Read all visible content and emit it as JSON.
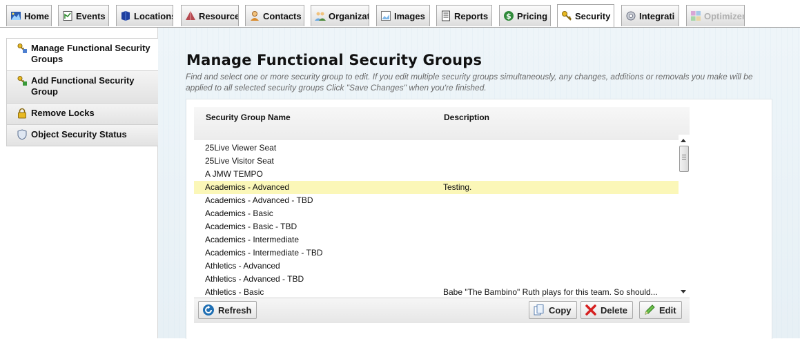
{
  "tabs": [
    {
      "label": "Home",
      "icon": "home-icon"
    },
    {
      "label": "Events",
      "icon": "events-icon"
    },
    {
      "label": "Locations",
      "icon": "locations-icon"
    },
    {
      "label": "Resource",
      "icon": "resource-icon"
    },
    {
      "label": "Contacts",
      "icon": "contacts-icon"
    },
    {
      "label": "Organizat",
      "icon": "organizations-icon"
    },
    {
      "label": "Images",
      "icon": "images-icon"
    },
    {
      "label": "Reports",
      "icon": "reports-icon"
    },
    {
      "label": "Pricing",
      "icon": "pricing-icon"
    },
    {
      "label": "Security",
      "icon": "key-icon",
      "active": true
    },
    {
      "label": "Integrati",
      "icon": "integration-icon"
    },
    {
      "label": "Optimizer",
      "icon": "optimizer-icon",
      "disabled": true
    }
  ],
  "sidebar": {
    "items": [
      {
        "label": "Manage Functional Security Groups",
        "icon": "security-group-icon",
        "current": true
      },
      {
        "label": "Add Functional Security Group",
        "icon": "security-group-add-icon"
      },
      {
        "label": "Remove Locks",
        "icon": "lock-icon"
      },
      {
        "label": "Object Security Status",
        "icon": "shield-icon"
      }
    ]
  },
  "main": {
    "title": "Manage Functional Security Groups",
    "instructions": "Find and select one or more security group to edit. If you edit multiple security groups simultaneously, any changes, additions or removals you make will be applied to all selected security groups Click \"Save Changes\" when you're finished."
  },
  "grid": {
    "columns": [
      "Security Group Name",
      "Description"
    ],
    "rows": [
      {
        "name": "25Live Viewer Seat",
        "description": ""
      },
      {
        "name": "25Live Visitor Seat",
        "description": ""
      },
      {
        "name": "A JMW TEMPO",
        "description": ""
      },
      {
        "name": "Academics - Advanced",
        "description": "Testing.",
        "selected": true
      },
      {
        "name": "Academics - Advanced - TBD",
        "description": ""
      },
      {
        "name": "Academics - Basic",
        "description": ""
      },
      {
        "name": "Academics - Basic - TBD",
        "description": ""
      },
      {
        "name": "Academics - Intermediate",
        "description": ""
      },
      {
        "name": "Academics - Intermediate - TBD",
        "description": ""
      },
      {
        "name": "Athletics - Advanced",
        "description": ""
      },
      {
        "name": "Athletics - Advanced - TBD",
        "description": ""
      },
      {
        "name": "Athletics - Basic",
        "description": "Babe \"The Bambino\" Ruth plays for this team. So should..."
      }
    ]
  },
  "toolbar": {
    "refresh_label": "Refresh",
    "copy_label": "Copy",
    "delete_label": "Delete",
    "edit_label": "Edit"
  },
  "colors": {
    "selected_row": "#fbf7b8",
    "main_background": "#e9f2f7"
  }
}
